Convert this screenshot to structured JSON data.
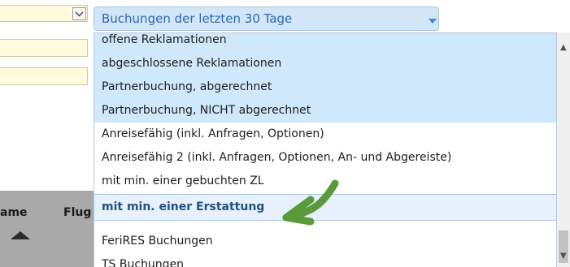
{
  "left_form": {
    "grid_labels": [
      "ame",
      "Flug"
    ]
  },
  "filter_select": {
    "selected": "Buchungen der letzten 30 Tage"
  },
  "dropdown": {
    "options": [
      "offene Reklamationen",
      "abgeschlossene Reklamationen",
      "Partnerbuchung, abgerechnet",
      "Partnerbuchung, NICHT abgerechnet",
      "Anreisefähig (inkl. Anfragen, Optionen)",
      "Anreisefähig 2 (inkl. Anfragen, Optionen, An- und Abgereiste)",
      "mit min. einer gebuchten ZL",
      "mit min. einer Erstattung",
      "FeriRES Buchungen",
      "TS Buchungen"
    ],
    "selected_indices": [
      0,
      1,
      2,
      3
    ],
    "highlighted_index": 7
  },
  "scroll": {
    "position_fraction": 0.88
  },
  "colors": {
    "selected_bg": "#cfe8fb",
    "highlight_bg": "#e7f1fb",
    "annotation_arrow": "#5a9a3a",
    "input_bg": "#fffbdc"
  }
}
